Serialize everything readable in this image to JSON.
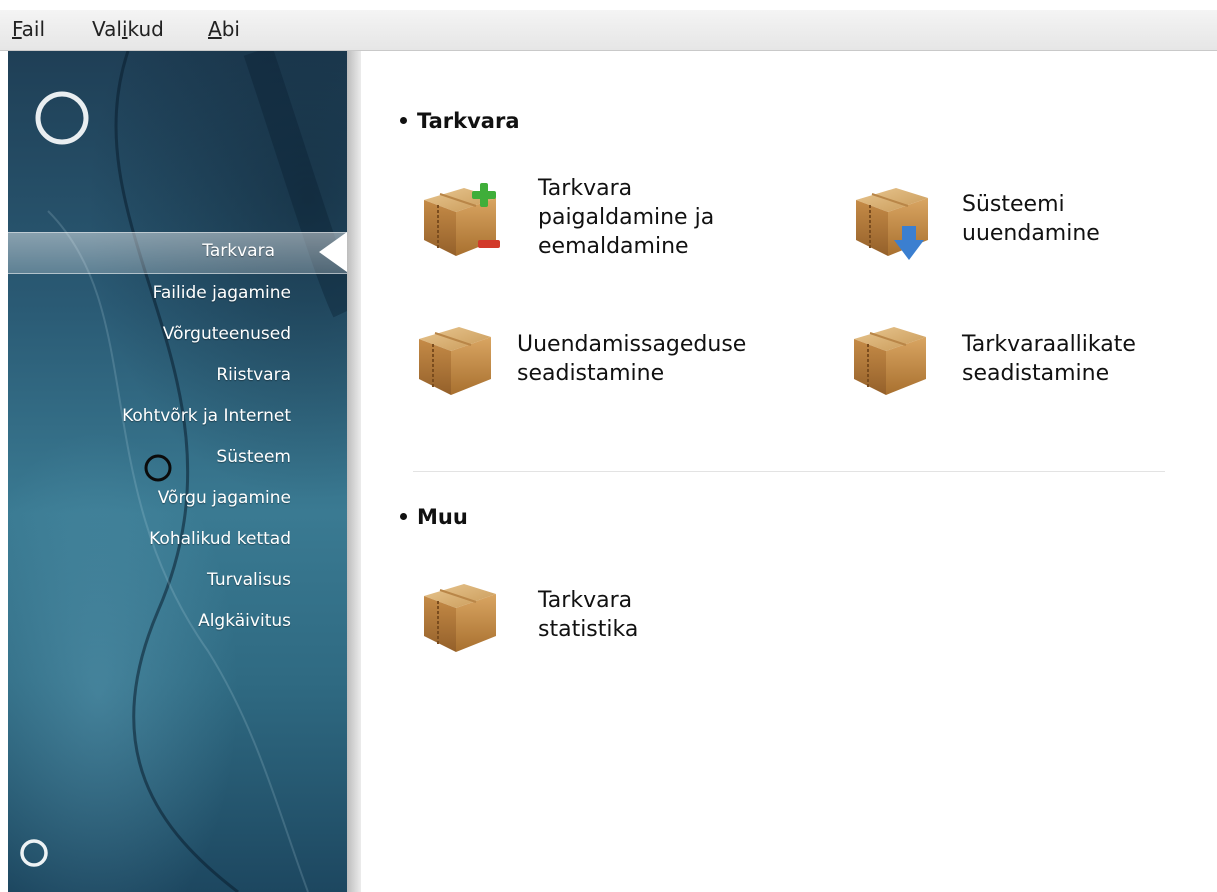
{
  "menubar": {
    "items": [
      {
        "pre": "",
        "accel": "F",
        "post": "ail"
      },
      {
        "pre": "Val",
        "accel": "i",
        "post": "kud"
      },
      {
        "pre": "",
        "accel": "A",
        "post": "bi"
      }
    ]
  },
  "sidebar": {
    "categories": [
      "Tarkvara",
      "Failide jagamine",
      "Võrguteenused",
      "Riistvara",
      "Kohtvõrk ja Internet",
      "Süsteem",
      "Võrgu jagamine",
      "Kohalikud kettad",
      "Turvalisus",
      "Algkäivitus"
    ],
    "active_index": 0
  },
  "sections": [
    {
      "title": "Tarkvara",
      "tools": [
        {
          "label": "Tarkvara\npaigaldamine ja\neemaldamine",
          "icon": "package-add-remove-icon"
        },
        {
          "label": "Süsteemi\nuuendamine",
          "icon": "package-update-icon"
        },
        {
          "label": "Uuendamissageduse\nseadistamine",
          "icon": "package-icon"
        },
        {
          "label": "Tarkvaraallikate\nseadistamine",
          "icon": "package-icon"
        }
      ]
    },
    {
      "title": "Muu",
      "tools": [
        {
          "label": "Tarkvara\nstatistika",
          "icon": "package-icon"
        }
      ]
    }
  ],
  "colors": {
    "sidebar_dark": "#1f3f56",
    "sidebar_mid": "#3a7a92",
    "box_brown": "#b07a3c",
    "plus_green": "#3fae3a",
    "minus_red": "#d23a2a",
    "arrow_blue": "#3b7fd0"
  }
}
